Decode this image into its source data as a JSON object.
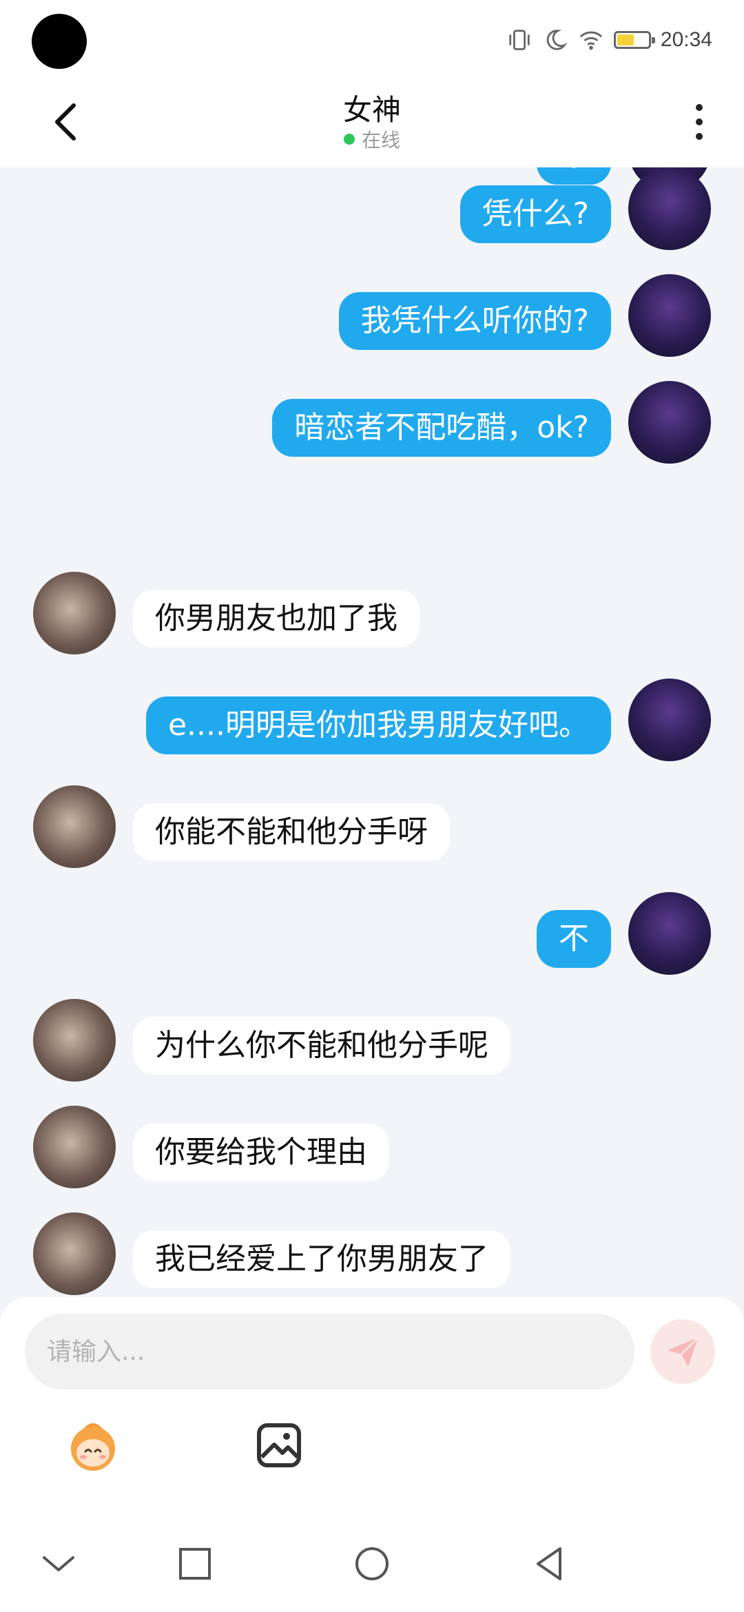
{
  "status_bar": {
    "time": "20:34",
    "battery_level": 0.55,
    "icons": [
      "vibrate-icon",
      "moon-icon",
      "wifi-icon",
      "battery-icon"
    ]
  },
  "header": {
    "title": "女神",
    "presence": "在线",
    "presence_color": "#2ec65a"
  },
  "messages": [
    {
      "side": "right",
      "text": "不"
    },
    {
      "side": "right",
      "text": "凭什么?"
    },
    {
      "side": "right",
      "text": "我凭什么听你的?"
    },
    {
      "side": "right",
      "text": "暗恋者不配吃醋，ok?"
    },
    {
      "side": "left",
      "text": "你男朋友也加了我"
    },
    {
      "side": "right",
      "text": "e....明明是你加我男朋友好吧。"
    },
    {
      "side": "left",
      "text": "你能不能和他分手呀"
    },
    {
      "side": "right",
      "text": "不"
    },
    {
      "side": "left",
      "text": "为什么你不能和他分手呢"
    },
    {
      "side": "left",
      "text": "你要给我个理由"
    },
    {
      "side": "left",
      "text": "我已经爱上了你男朋友了"
    }
  ],
  "composer": {
    "placeholder": "请输入...",
    "send_icon": "send-icon",
    "tools": [
      "emoji-icon",
      "image-icon"
    ]
  },
  "colors": {
    "accent": "#21a9ee",
    "background": "#f2f4f7"
  },
  "nav_bar": {
    "icons": [
      "chevron-down-icon",
      "recents-icon",
      "home-icon",
      "back-icon"
    ]
  }
}
